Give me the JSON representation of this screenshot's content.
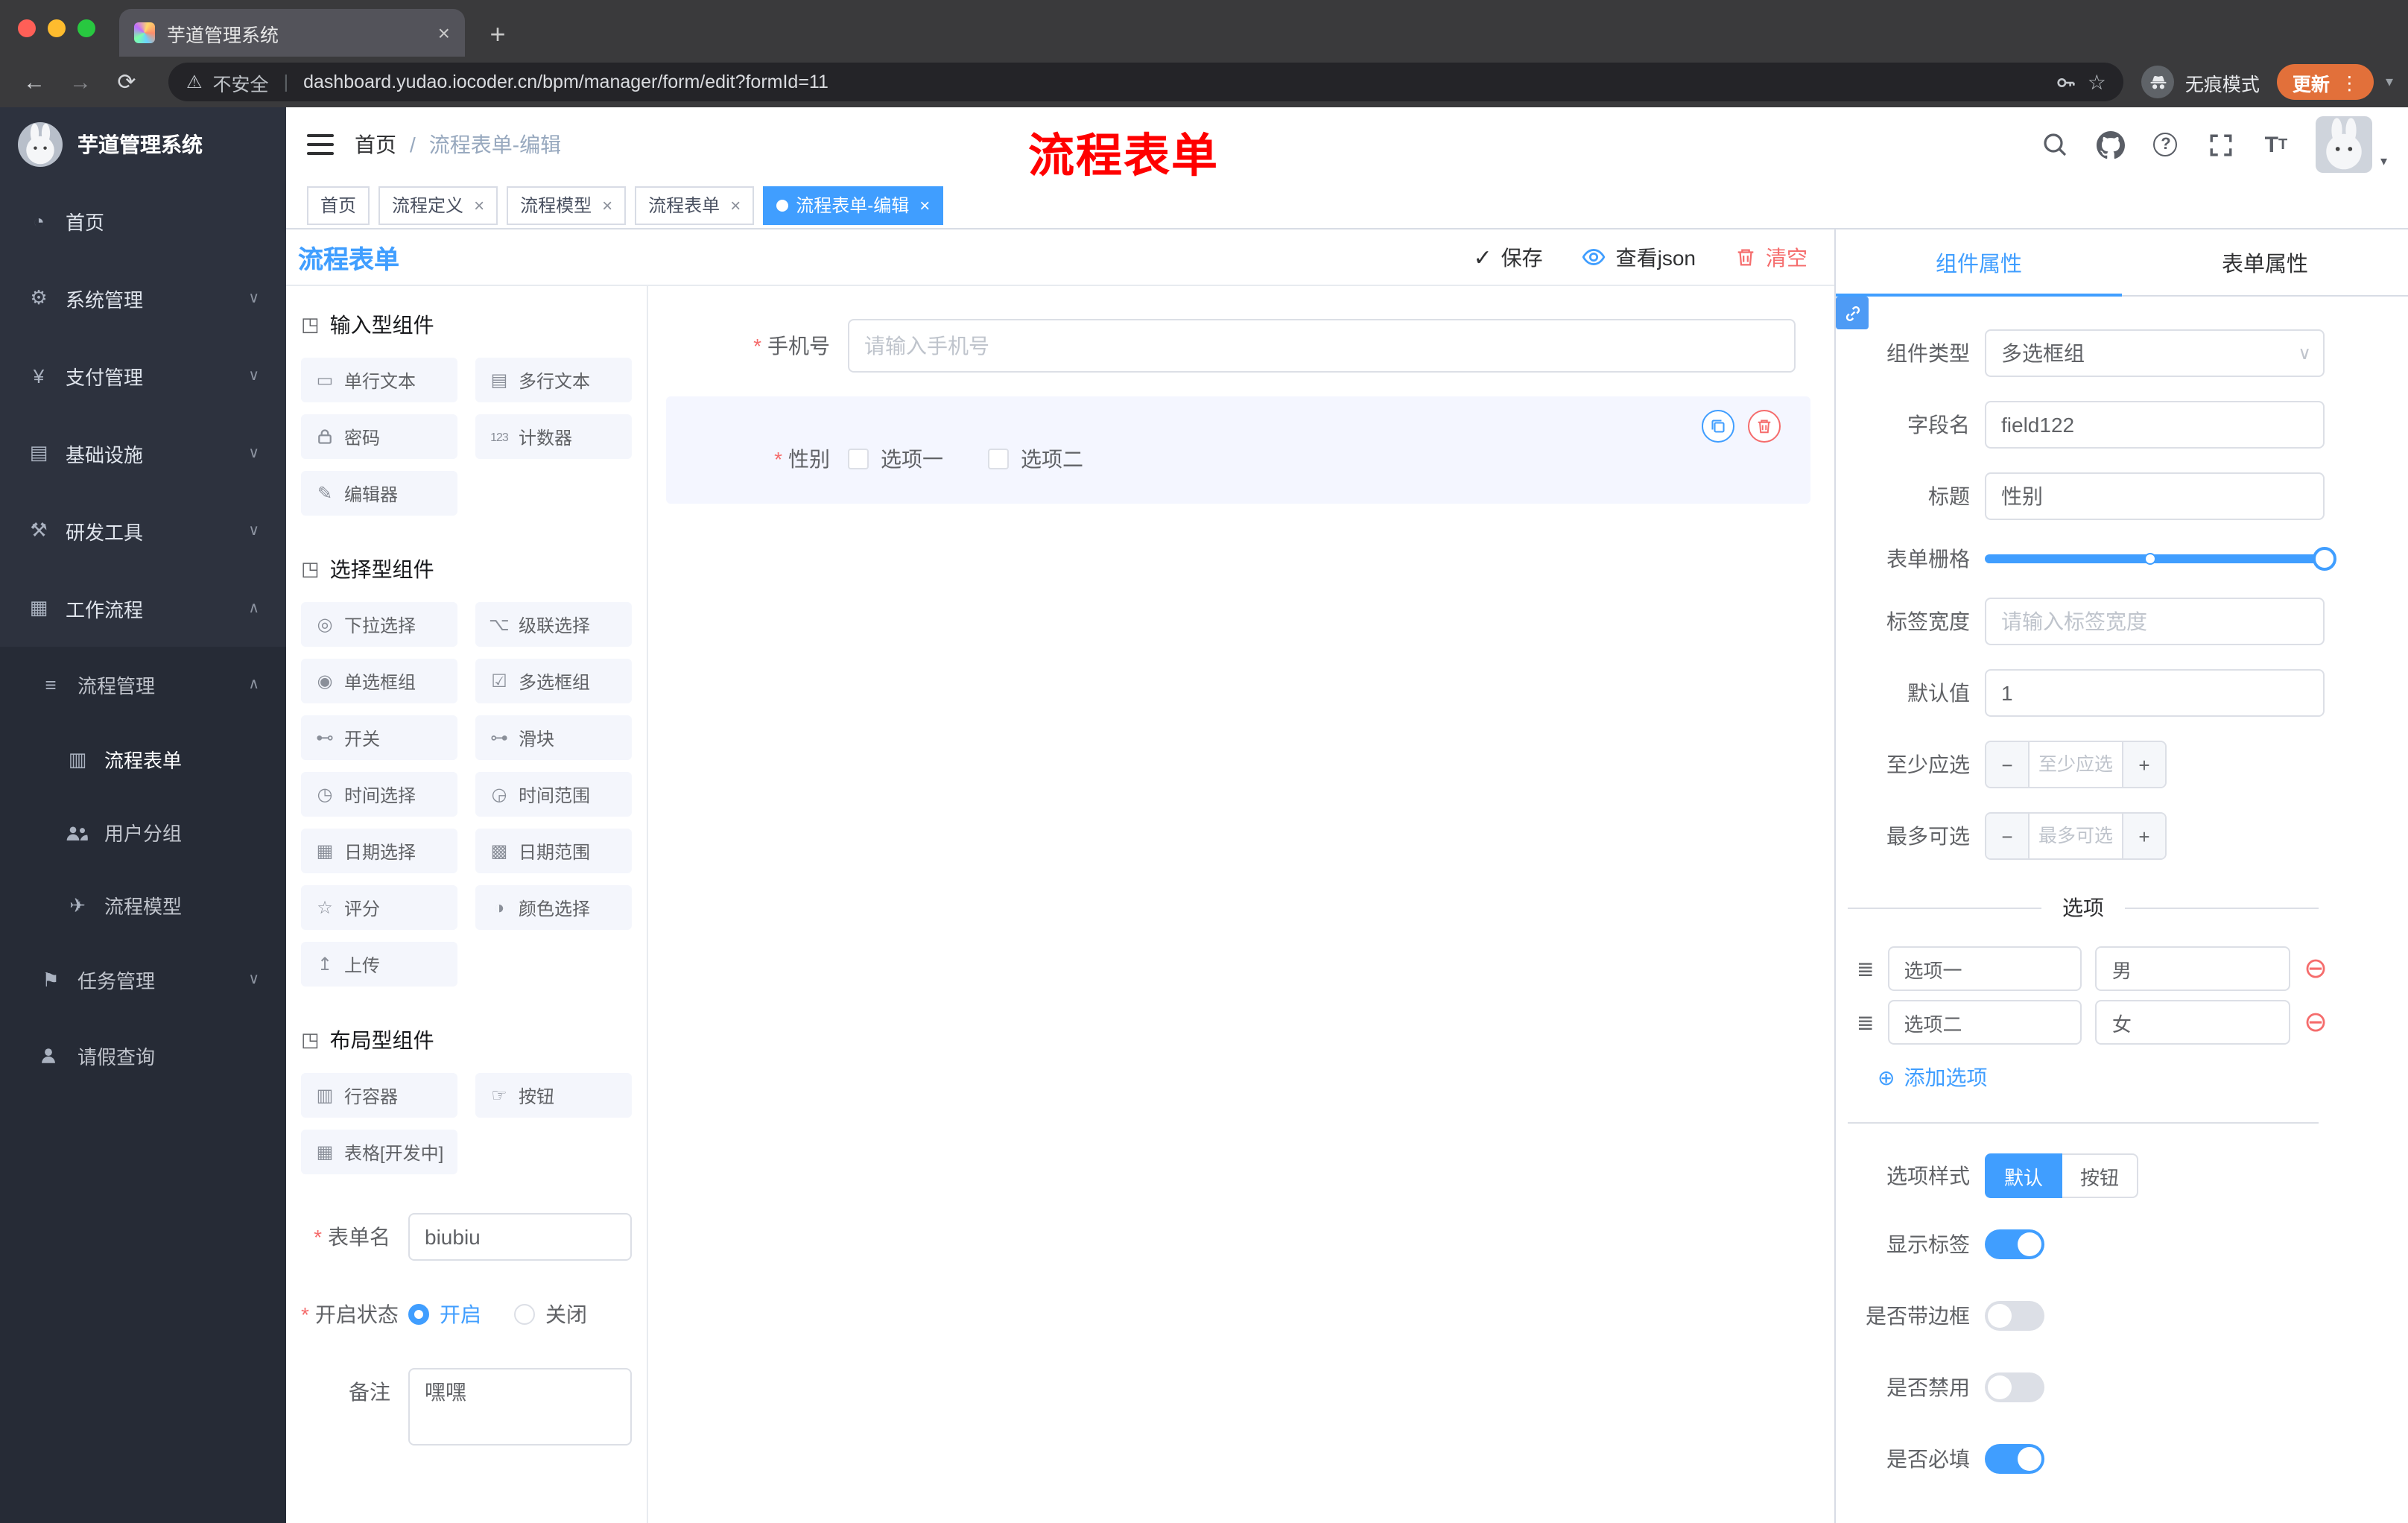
{
  "browser": {
    "tab_title": "芋道管理系统",
    "security_label": "不安全",
    "url": "dashboard.yudao.iocoder.cn/bpm/manager/form/edit?formId=11",
    "incognito_label": "无痕模式",
    "update_label": "更新"
  },
  "sidebar": {
    "app_title": "芋道管理系统",
    "menu": [
      {
        "label": "首页"
      },
      {
        "label": "系统管理"
      },
      {
        "label": "支付管理"
      },
      {
        "label": "基础设施"
      },
      {
        "label": "研发工具"
      },
      {
        "label": "工作流程"
      },
      {
        "label": "流程管理"
      },
      {
        "label": "流程表单"
      },
      {
        "label": "用户分组"
      },
      {
        "label": "流程模型"
      },
      {
        "label": "任务管理"
      },
      {
        "label": "请假查询"
      }
    ]
  },
  "navbar": {
    "breadcrumb": {
      "home": "首页",
      "separator": "/",
      "current": "流程表单-编辑"
    },
    "annotation": "流程表单"
  },
  "tags": [
    {
      "label": "首页",
      "closable": false,
      "active": false
    },
    {
      "label": "流程定义",
      "closable": true,
      "active": false
    },
    {
      "label": "流程模型",
      "closable": true,
      "active": false
    },
    {
      "label": "流程表单",
      "closable": true,
      "active": false
    },
    {
      "label": "流程表单-编辑",
      "closable": true,
      "active": true
    }
  ],
  "designer": {
    "title": "流程表单",
    "actions": {
      "save": "保存",
      "view_json": "查看json",
      "clear": "清空"
    },
    "sections": [
      {
        "title": "输入型组件",
        "items": [
          {
            "label": "单行文本"
          },
          {
            "label": "多行文本"
          },
          {
            "label": "密码"
          },
          {
            "label": "计数器"
          },
          {
            "label": "编辑器"
          }
        ]
      },
      {
        "title": "选择型组件",
        "items": [
          {
            "label": "下拉选择"
          },
          {
            "label": "级联选择"
          },
          {
            "label": "单选框组"
          },
          {
            "label": "多选框组"
          },
          {
            "label": "开关"
          },
          {
            "label": "滑块"
          },
          {
            "label": "时间选择"
          },
          {
            "label": "时间范围"
          },
          {
            "label": "日期选择"
          },
          {
            "label": "日期范围"
          },
          {
            "label": "评分"
          },
          {
            "label": "颜色选择"
          },
          {
            "label": "上传"
          }
        ]
      },
      {
        "title": "布局型组件",
        "items": [
          {
            "label": "行容器"
          },
          {
            "label": "按钮"
          },
          {
            "label": "表格[开发中]"
          }
        ]
      }
    ],
    "meta": {
      "form_name_label": "表单名",
      "form_name_value": "biubiu",
      "status_label": "开启状态",
      "status_on": "开启",
      "status_off": "关闭",
      "remark_label": "备注",
      "remark_value": "嘿嘿"
    },
    "canvas": {
      "phone": {
        "label": "手机号",
        "placeholder": "请输入手机号"
      },
      "gender": {
        "label": "性别",
        "options": [
          "选项一",
          "选项二"
        ]
      }
    }
  },
  "props": {
    "tabs": {
      "component": "组件属性",
      "form": "表单属性"
    },
    "component_type": {
      "label": "组件类型",
      "value": "多选框组"
    },
    "field_name": {
      "label": "字段名",
      "value": "field122"
    },
    "title": {
      "label": "标题",
      "value": "性别"
    },
    "grid": {
      "label": "表单栅格"
    },
    "label_width": {
      "label": "标签宽度",
      "placeholder": "请输入标签宽度"
    },
    "default_value": {
      "label": "默认值",
      "value": "1"
    },
    "min_select": {
      "label": "至少应选",
      "placeholder": "至少应选"
    },
    "max_select": {
      "label": "最多可选",
      "placeholder": "最多可选"
    },
    "options": {
      "divider": "选项",
      "rows": [
        {
          "label": "选项一",
          "value": "男"
        },
        {
          "label": "选项二",
          "value": "女"
        }
      ],
      "add": "添加选项"
    },
    "option_style": {
      "label": "选项样式",
      "default": "默认",
      "button": "按钮"
    },
    "toggles": [
      {
        "label": "显示标签",
        "on": true
      },
      {
        "label": "是否带边框",
        "on": false
      },
      {
        "label": "是否禁用",
        "on": false
      },
      {
        "label": "是否必填",
        "on": true
      }
    ]
  },
  "icons": {
    "back-icon": "←",
    "forward-icon": "→",
    "reload-icon": "⟳",
    "warning-icon": "⚠",
    "star-icon": "☆",
    "more-vert-icon": "⋮",
    "caret-down-icon": "▾",
    "new-tab-icon": "+",
    "close-icon": "×",
    "dashboard-icon": "◔",
    "gear-icon": "⚙",
    "payment-icon": "¥",
    "infrastructure-icon": "▤",
    "devtools-icon": "⚒",
    "workflow-icon": "▦",
    "process-management-icon": "≡",
    "process-form-icon": "▥",
    "process-model-icon": "✈",
    "task-management-icon": "⚑",
    "chevron-down-icon": "∨",
    "chevron-up-icon": "∧",
    "check-icon": "✓",
    "section-cube-icon": "◳",
    "single-line-text-icon": "▭",
    "multi-line-text-icon": "▤",
    "counter-icon": "123",
    "editor-icon": "✎",
    "select-icon": "◎",
    "cascader-icon": "⌥",
    "radio-group-icon": "◉",
    "checkbox-group-icon": "☑",
    "switch-icon": "⊷",
    "slider-icon": "⊶",
    "time-picker-icon": "◷",
    "time-range-icon": "◶",
    "date-picker-icon": "▦",
    "date-range-icon": "▩",
    "rate-icon": "☆",
    "color-picker-icon": "◑",
    "upload-icon": "↥",
    "row-container-icon": "▥",
    "button-icon": "☞",
    "table-icon": "▦",
    "option-drag-icon": "≣",
    "remove-option-icon": "⊖",
    "add-option-icon": "⊕",
    "select-arrow-icon": "∨",
    "stepper-minus-icon": "−",
    "stepper-plus-icon": "+"
  }
}
